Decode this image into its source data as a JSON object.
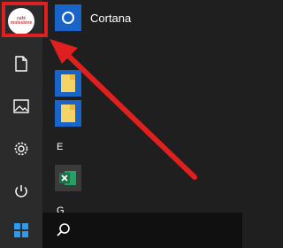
{
  "rail": {
    "avatar_text": "café\nmoleskine",
    "items": [
      {
        "name": "documents-icon"
      },
      {
        "name": "pictures-icon"
      },
      {
        "name": "settings-icon"
      },
      {
        "name": "power-icon"
      }
    ]
  },
  "apps": {
    "cortana_label": "Cortana",
    "section_e": "E",
    "section_g": "G"
  },
  "colors": {
    "accent_red": "#e0201e",
    "tile_blue": "#1864c8",
    "excel_green": "#1e7145",
    "folder_yellow": "#f6d365",
    "windows_blue": "#2d9cf0"
  }
}
